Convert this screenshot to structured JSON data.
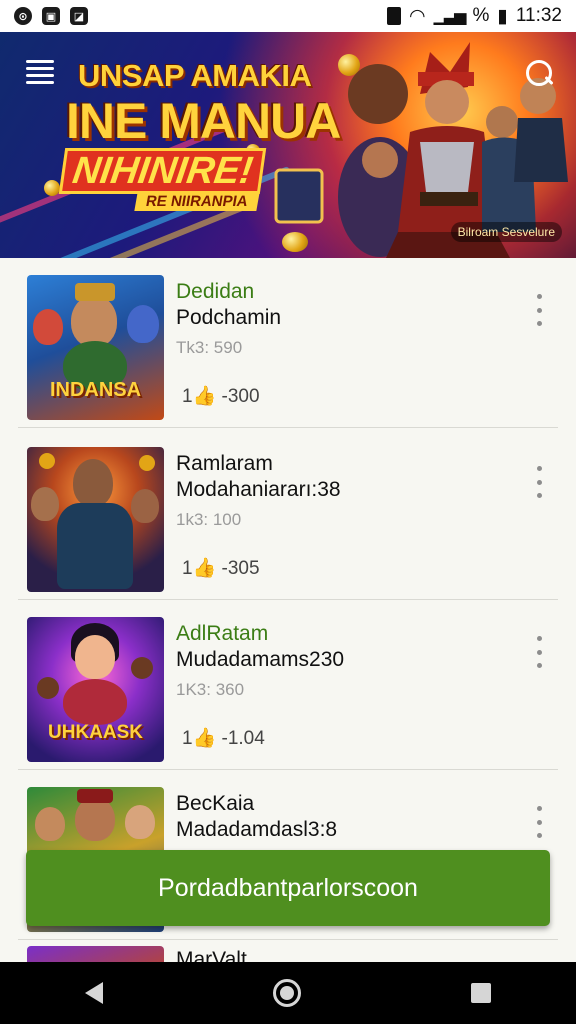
{
  "status_bar": {
    "left_icons": [
      "sync-icon",
      "image-icon",
      "notification-icon"
    ],
    "right_icons": [
      "sim-icon",
      "wifi-icon",
      "signal-icon"
    ],
    "signal_text": "%",
    "time": "11:32"
  },
  "banner": {
    "title_line1": "UNSAP AMAKIA",
    "title_line2": "INE MANUA",
    "title_line3": "NIHINIRE!",
    "tagline": "RE NIIRANPIA",
    "badge": "Bilroam Sesvelure"
  },
  "list": {
    "items": [
      {
        "title": "Dedidan",
        "subtitle": "Podchamin",
        "meta": "Tk3: 590",
        "stat": "1👍 -300",
        "thumb_label": "INDANSA",
        "title_color": "#3b7d15"
      },
      {
        "title": "Ramlaram",
        "subtitle": "Modahaniararı:38",
        "meta": "1k3: 100",
        "stat": "1👍 -305",
        "thumb_label": "",
        "title_color": "#111111"
      },
      {
        "title": "AdlRatam",
        "subtitle": "Mudadamams230",
        "meta": "1K3: 360",
        "stat": "1👍 -1.04",
        "thumb_label": "UHKAASK",
        "title_color": "#3b7d15"
      },
      {
        "title": "BecKaia",
        "subtitle": "Madadamdasl3:8",
        "meta": "",
        "stat": "",
        "thumb_label": "",
        "title_color": "#111111"
      }
    ]
  },
  "partial_item_title": "MarValt",
  "cta": {
    "label": "Pordadbantparlorscoon",
    "color": "#4f8f1f"
  },
  "nav_bar": {
    "back": "back-icon",
    "home": "home-icon",
    "recent": "recent-apps-icon"
  }
}
